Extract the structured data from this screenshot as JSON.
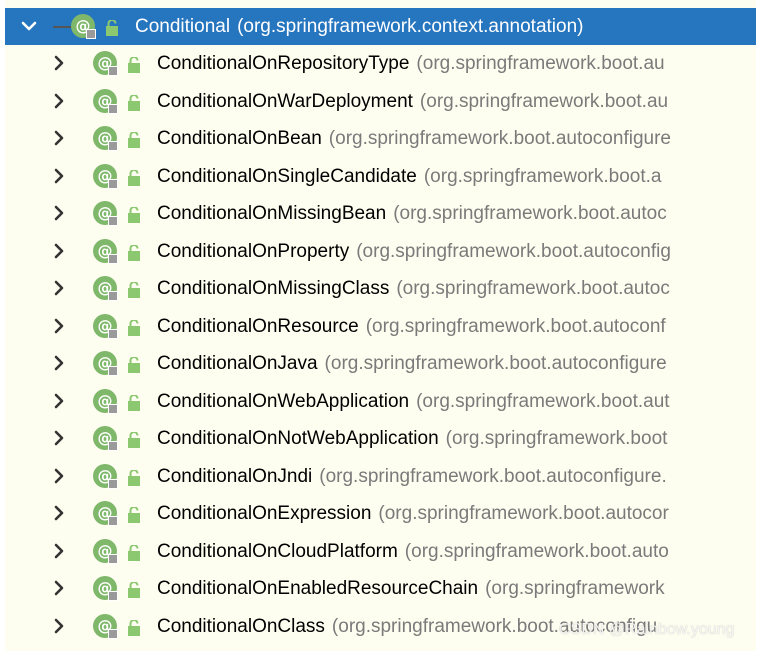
{
  "root": {
    "name": "Conditional",
    "package": "(org.springframework.context.annotation)"
  },
  "items": [
    {
      "name": "ConditionalOnRepositoryType",
      "package": "(org.springframework.boot.au"
    },
    {
      "name": "ConditionalOnWarDeployment",
      "package": "(org.springframework.boot.au"
    },
    {
      "name": "ConditionalOnBean",
      "package": "(org.springframework.boot.autoconfigure"
    },
    {
      "name": "ConditionalOnSingleCandidate",
      "package": "(org.springframework.boot.a"
    },
    {
      "name": "ConditionalOnMissingBean",
      "package": "(org.springframework.boot.autoc"
    },
    {
      "name": "ConditionalOnProperty",
      "package": "(org.springframework.boot.autoconfig"
    },
    {
      "name": "ConditionalOnMissingClass",
      "package": "(org.springframework.boot.autoc"
    },
    {
      "name": "ConditionalOnResource",
      "package": "(org.springframework.boot.autoconf"
    },
    {
      "name": "ConditionalOnJava",
      "package": "(org.springframework.boot.autoconfigure"
    },
    {
      "name": "ConditionalOnWebApplication",
      "package": "(org.springframework.boot.aut"
    },
    {
      "name": "ConditionalOnNotWebApplication",
      "package": "(org.springframework.boot"
    },
    {
      "name": "ConditionalOnJndi",
      "package": "(org.springframework.boot.autoconfigure."
    },
    {
      "name": "ConditionalOnExpression",
      "package": "(org.springframework.boot.autocor"
    },
    {
      "name": "ConditionalOnCloudPlatform",
      "package": "(org.springframework.boot.auto"
    },
    {
      "name": "ConditionalOnEnabledResourceChain",
      "package": "(org.springframework"
    },
    {
      "name": "ConditionalOnClass",
      "package": "(org.springframework.boot.autoconfigu"
    }
  ],
  "annotation_symbol": "@",
  "watermark": "CSDN @Rainbow.young",
  "icons": {
    "expanded": "chevron-down-icon",
    "collapsed": "chevron-right-icon",
    "annotation": "annotation-icon",
    "access": "lock-icon"
  },
  "colors": {
    "selection": "#2675bf",
    "background": "#fefef0",
    "annotation_green": "#7fb86a",
    "package_gray": "#7a7a7a"
  }
}
